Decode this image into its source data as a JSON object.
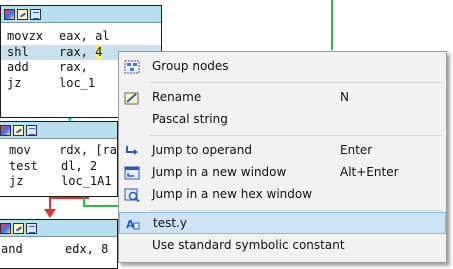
{
  "colors": {
    "node_title_bg": "#b8dff0",
    "edge_cyan": "#00c8e8",
    "edge_green": "#2cb84a",
    "edge_red": "#e03030",
    "menu_bg": "#f2f2f2",
    "menu_active": "#cfe3f7",
    "operand_highlight": "#f3f07a"
  },
  "nodes": [
    {
      "lines": [
        {
          "mnemonic": "movzx",
          "operand": "eax, al"
        },
        {
          "mnemonic": "shl",
          "operand": "rax, ",
          "highlight": "4"
        },
        {
          "mnemonic": "add",
          "operand": "rax,"
        },
        {
          "mnemonic": "jz",
          "operand": "loc_1"
        }
      ]
    },
    {
      "lines": [
        {
          "mnemonic": "mov",
          "operand": "rdx, [ra"
        },
        {
          "mnemonic": "test",
          "operand": "dl, 2"
        },
        {
          "mnemonic": "jz",
          "operand": "loc_1A1"
        }
      ]
    },
    {
      "lines": [
        {
          "mnemonic": "and",
          "operand": "edx, 8"
        }
      ]
    }
  ],
  "context_menu": {
    "items": [
      {
        "label": "Group nodes",
        "shortcut": "",
        "icon": "group-nodes-icon"
      },
      {
        "label": "Rename",
        "shortcut": "N",
        "icon": "rename-icon"
      },
      {
        "label": "Pascal string",
        "shortcut": "",
        "icon": ""
      },
      {
        "label": "Jump to operand",
        "shortcut": "Enter",
        "icon": "jump-arrow-icon"
      },
      {
        "label": "Jump in a new window",
        "shortcut": "Alt+Enter",
        "icon": "new-window-icon"
      },
      {
        "label": "Jump in a new hex window",
        "shortcut": "",
        "icon": "hex-window-icon"
      },
      {
        "label": "test.y",
        "shortcut": "",
        "icon": "structure-offset-icon"
      },
      {
        "label": "Use standard symbolic constant",
        "shortcut": "",
        "icon": ""
      }
    ]
  }
}
